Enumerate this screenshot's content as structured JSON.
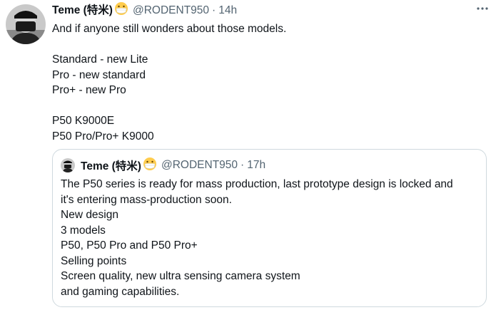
{
  "tweet": {
    "display_name": "Teme (特米)",
    "handle": "@RODENT950",
    "separator": "·",
    "time": "14h",
    "lines": [
      "And if anyone still wonders about those models.",
      "",
      "Standard - new Lite",
      "Pro - new standard",
      "Pro+ - new Pro",
      "",
      "P50 K9000E",
      "P50 Pro/Pro+ K9000"
    ]
  },
  "quoted_tweet": {
    "display_name": "Teme (特米)",
    "handle": "@RODENT950",
    "separator": "·",
    "time": "17h",
    "lines": [
      "The P50 series is ready for mass production, last prototype design is locked and",
      "it's entering mass-production soon.",
      "New design",
      "3 models",
      "P50, P50 Pro and P50 Pro+",
      "Selling points",
      "Screen quality, new ultra sensing camera system",
      "and gaming capabilities."
    ]
  },
  "icons": {
    "avatar": "user-avatar-icon",
    "emoji": "mask-face-emoji-icon",
    "more": "more-options-icon"
  },
  "colors": {
    "text": "#0f1419",
    "secondary": "#536471",
    "border": "#cfd9de"
  }
}
